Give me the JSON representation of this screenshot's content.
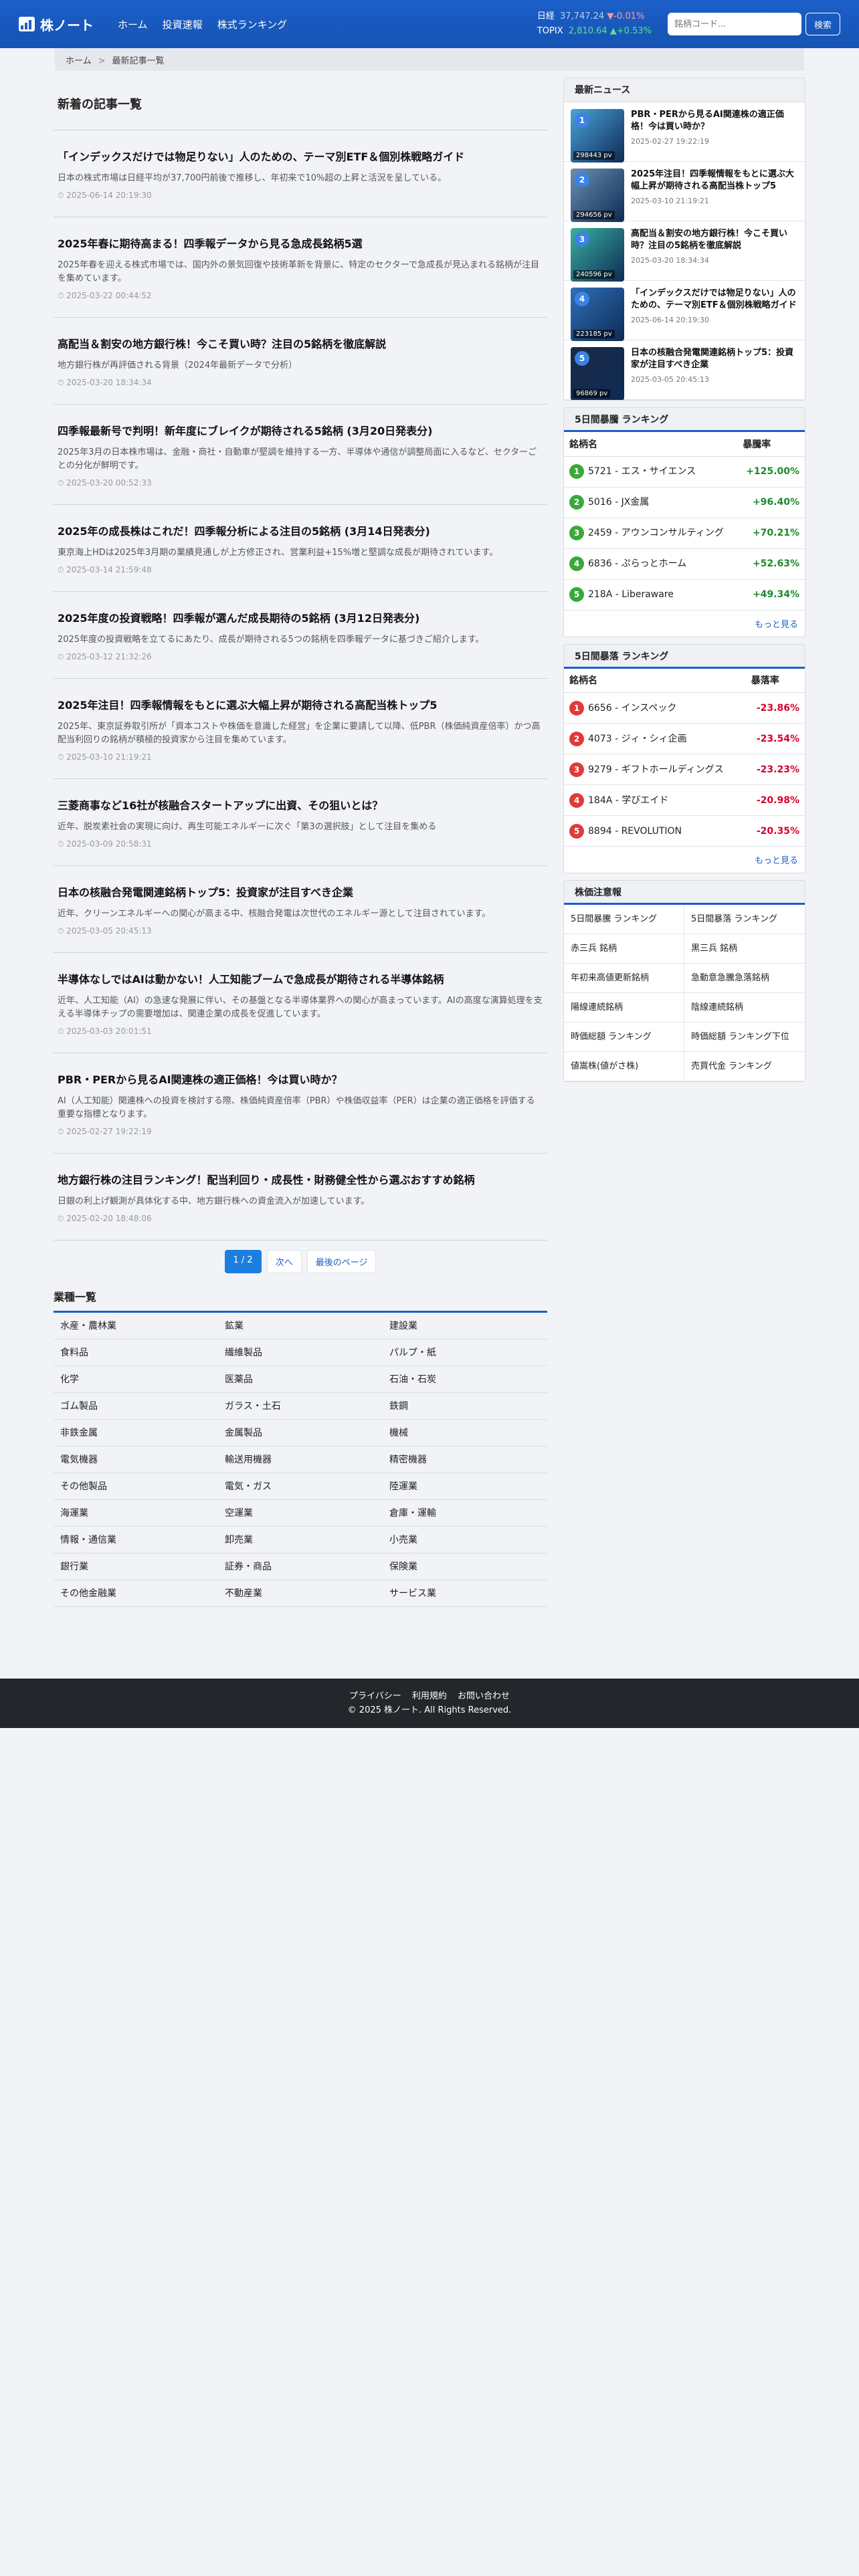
{
  "header": {
    "logo": "株ノート",
    "nav": [
      "ホーム",
      "投資速報",
      "株式ランキング"
    ],
    "nikkei_label": "日経",
    "nikkei_value": "37,747.24",
    "nikkei_change": "▼-0.01%",
    "topix_label": "TOPIX",
    "topix_value": "2,810.64",
    "topix_change": "▲+0.53%",
    "search_placeholder": "銘柄コード...",
    "search_button": "検索"
  },
  "breadcrumb": {
    "home": "ホーム",
    "sep": ">",
    "current": "最新記事一覧"
  },
  "main": {
    "title": "新着の記事一覧",
    "articles": [
      {
        "title": "「インデックスだけでは物足りない」人のための、テーマ別ETF＆個別株戦略ガイド",
        "desc": "日本の株式市場は日経平均が37,700円前後で推移し、年初来で10%超の上昇と活況を呈している。",
        "date": "2025-06-14 20:19:30"
      },
      {
        "title": "2025年春に期待高まる！四季報データから見る急成長銘柄5選",
        "desc": "2025年春を迎える株式市場では、国内外の景気回復や技術革新を背景に、特定のセクターで急成長が見込まれる銘柄が注目を集めています。",
        "date": "2025-03-22 00:44:52"
      },
      {
        "title": "高配当＆割安の地方銀行株！今こそ買い時？注目の5銘柄を徹底解説",
        "desc": "地方銀行株が再評価される背景（2024年最新データで分析）",
        "date": "2025-03-20 18:34:34"
      },
      {
        "title": "四季報最新号で判明！新年度にブレイクが期待される5銘柄 (3月20日発表分)",
        "desc": "2025年3月の日本株市場は、金融・商社・自動車が堅調を維持する一方、半導体や通信が調整局面に入るなど、セクターごとの分化が鮮明です。",
        "date": "2025-03-20 00:52:33"
      },
      {
        "title": "2025年の成長株はこれだ！四季報分析による注目の5銘柄 (3月14日発表分)",
        "desc": "東京海上HDは2025年3月期の業績見通しが上方修正され、営業利益+15%増と堅調な成長が期待されています。",
        "date": "2025-03-14 21:59:48"
      },
      {
        "title": "2025年度の投資戦略！四季報が選んだ成長期待の5銘柄 (3月12日発表分)",
        "desc": "2025年度の投資戦略を立てるにあたり、成長が期待される5つの銘柄を四季報データに基づきご紹介します。",
        "date": "2025-03-12 21:32:26"
      },
      {
        "title": "2025年注目！四季報情報をもとに選ぶ大幅上昇が期待される高配当株トップ5",
        "desc": "2025年、東京証券取引所が「資本コストや株価を意識した経営」を企業に要請して以降、低PBR（株価純資産倍率）かつ高配当利回りの銘柄が積極的投資家から注目を集めています。",
        "date": "2025-03-10 21:19:21"
      },
      {
        "title": "三菱商事など16社が核融合スタートアップに出資、その狙いとは？",
        "desc": "近年、脱炭素社会の実現に向け、再生可能エネルギーに次ぐ「第3の選択肢」として注目を集める",
        "date": "2025-03-09 20:58:31"
      },
      {
        "title": "日本の核融合発電関連銘柄トップ5：投資家が注目すべき企業",
        "desc": "近年、クリーンエネルギーへの関心が高まる中、核融合発電は次世代のエネルギー源として注目されています。",
        "date": "2025-03-05 20:45:13"
      },
      {
        "title": "半導体なしではAIは動かない！人工知能ブームで急成長が期待される半導体銘柄",
        "desc": "近年、人工知能（AI）の急速な発展に伴い、その基盤となる半導体業界への関心が高まっています。AIの高度な演算処理を支える半導体チップの需要増加は、関連企業の成長を促進しています。",
        "date": "2025-03-03 20:01:51"
      },
      {
        "title": "PBR・PERから見るAI関連株の適正価格！今は買い時か？",
        "desc": "AI（人工知能）関連株への投資を検討する際、株価純資産倍率（PBR）や株価収益率（PER）は企業の適正価格を評価する重要な指標となります。",
        "date": "2025-02-27 19:22:19"
      },
      {
        "title": "地方銀行株の注目ランキング！配当利回り・成長性・財務健全性から選ぶおすすめ銘柄",
        "desc": "日銀の利上げ観測が具体化する中、地方銀行株への資金流入が加速しています。",
        "date": "2025-02-20 18:48:06"
      }
    ],
    "pager": {
      "current": "1 / 2",
      "next": "次へ",
      "last": "最後のページ"
    },
    "gyoshu_title": "業種一覧",
    "gyoshu": [
      "水産・農林業",
      "鉱業",
      "建設業",
      "食料品",
      "繊維製品",
      "パルプ・紙",
      "化学",
      "医薬品",
      "石油・石炭",
      "ゴム製品",
      "ガラス・土石",
      "鉄鋼",
      "非鉄金属",
      "金属製品",
      "機械",
      "電気機器",
      "輸送用機器",
      "精密機器",
      "その他製品",
      "電気・ガス",
      "陸運業",
      "海運業",
      "空運業",
      "倉庫・運輸",
      "情報・通信業",
      "卸売業",
      "小売業",
      "銀行業",
      "証券・商品",
      "保険業",
      "その他金融業",
      "不動産業",
      "サービス業"
    ]
  },
  "sidebar": {
    "news_title": "最新ニュース",
    "news": [
      {
        "rank": "1",
        "pv": "298443 pv",
        "title": "PBR・PERから見るAI関連株の適正価格！今は買い時か？",
        "date": "2025-02-27 19:22:19",
        "color": "#4aa3d8"
      },
      {
        "rank": "2",
        "pv": "294656 pv",
        "title": "2025年注目！四季報情報をもとに選ぶ大幅上昇が期待される高配当株トップ5",
        "date": "2025-03-10 21:19:21",
        "color": "#6a8fb0"
      },
      {
        "rank": "3",
        "pv": "240596 pv",
        "title": "高配当＆割安の地方銀行株！今こそ買い時？注目の5銘柄を徹底解説",
        "date": "2025-03-20 18:34:34",
        "color": "#3bb0a0"
      },
      {
        "rank": "4",
        "pv": "223185 pv",
        "title": "「インデックスだけでは物足りない」人のための、テーマ別ETF＆個別株戦略ガイド",
        "date": "2025-06-14 20:19:30",
        "color": "#2f6fb8"
      },
      {
        "rank": "5",
        "pv": "96869 pv",
        "title": "日本の核融合発電関連銘柄トップ5：投資家が注目すべき企業",
        "date": "2025-03-05 20:45:13",
        "color": "#1c2a44"
      }
    ],
    "up_title": "5日間暴騰 ランキング",
    "up_headers": [
      "銘柄名",
      "暴騰率"
    ],
    "up": [
      {
        "rank": "1",
        "name": "5721 - エス・サイエンス",
        "pct": "+125.00%"
      },
      {
        "rank": "2",
        "name": "5016 - JX金属",
        "pct": "+96.40%"
      },
      {
        "rank": "3",
        "name": "2459 - アウンコンサルティング",
        "pct": "+70.21%"
      },
      {
        "rank": "4",
        "name": "6836 - ぷらっとホーム",
        "pct": "+52.63%"
      },
      {
        "rank": "5",
        "name": "218A - Liberaware",
        "pct": "+49.34%"
      }
    ],
    "down_title": "5日間暴落 ランキング",
    "down_headers": [
      "銘柄名",
      "暴落率"
    ],
    "down": [
      {
        "rank": "1",
        "name": "6656 - インスペック",
        "pct": "-23.86%"
      },
      {
        "rank": "2",
        "name": "4073 - ジィ・シィ企画",
        "pct": "-23.54%"
      },
      {
        "rank": "3",
        "name": "9279 - ギフトホールディングス",
        "pct": "-23.23%"
      },
      {
        "rank": "4",
        "name": "184A - 学びエイド",
        "pct": "-20.98%"
      },
      {
        "rank": "5",
        "name": "8894 - REVOLUTION",
        "pct": "-20.35%"
      }
    ],
    "more": "もっと見る",
    "kabuka_title": "株価注意報",
    "kabuka": [
      "5日間暴騰 ランキング",
      "5日間暴落 ランキング",
      "赤三兵 銘柄",
      "黒三兵 銘柄",
      "年初来高値更新銘柄",
      "急動意急騰急落銘柄",
      "陽線連続銘柄",
      "陰線連続銘柄",
      "時価総額 ランキング",
      "時価総額 ランキング下位",
      "値嵩株(値がさ株)",
      "売買代金 ランキング"
    ]
  },
  "footer": {
    "links": [
      "プライバシー",
      "利用規約",
      "お問い合わせ"
    ],
    "copyright": "© 2025 株ノート. All Rights Reserved."
  }
}
